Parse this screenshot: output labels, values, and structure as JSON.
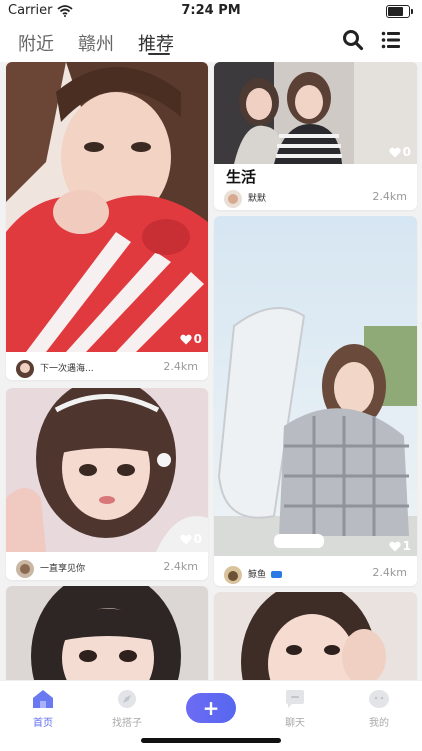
{
  "status_bar": {
    "carrier": "Carrier",
    "time": "7:24 PM",
    "battery_level": 0.8
  },
  "header": {
    "tabs": [
      {
        "label": "附近"
      },
      {
        "label": "赣州"
      },
      {
        "label": "推荐",
        "active": true
      }
    ],
    "icons": [
      "search-icon",
      "list-icon"
    ]
  },
  "feed": {
    "cards": [
      {
        "likes": "0",
        "username": "下一次遇海...",
        "distance": "2.4km"
      },
      {
        "likes": "0",
        "title": "生活",
        "username": "默默",
        "distance": "2.4km"
      },
      {
        "likes": "0",
        "username": "一直享见你",
        "distance": "2.4km"
      },
      {
        "likes": "1",
        "username": "鲸鱼",
        "distance": "2.4km"
      }
    ]
  },
  "tab_bar": {
    "items": [
      {
        "label": "首页",
        "icon": "home-icon",
        "active": true
      },
      {
        "label": "找搭子",
        "icon": "compass-icon"
      },
      {
        "label": "+",
        "icon": "plus-icon"
      },
      {
        "label": "聊天",
        "icon": "chat-icon"
      },
      {
        "label": "我的",
        "icon": "profile-icon"
      }
    ]
  },
  "colors": {
    "accent": "#5f6ef0",
    "jacket_red": "#e03a3f"
  }
}
